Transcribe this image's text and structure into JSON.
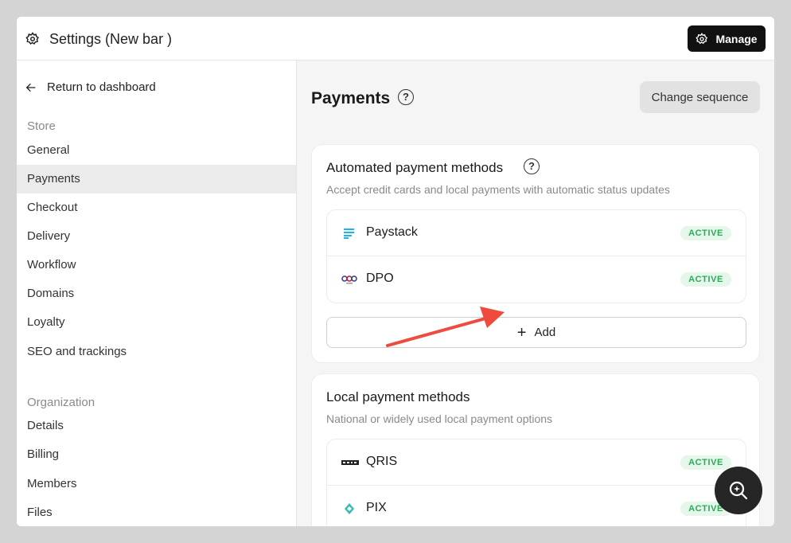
{
  "header": {
    "title": "Settings (New bar )",
    "manage_label": "Manage"
  },
  "sidebar": {
    "back_label": "Return to dashboard",
    "store_label": "Store",
    "store_items": [
      "General",
      "Payments",
      "Checkout",
      "Delivery",
      "Workflow",
      "Domains",
      "Loyalty",
      "SEO and trackings"
    ],
    "active_item": "Payments",
    "org_label": "Organization",
    "org_items": [
      "Details",
      "Billing",
      "Members",
      "Files"
    ]
  },
  "main": {
    "title": "Payments",
    "help_glyph": "?",
    "change_sequence_label": "Change sequence",
    "automated": {
      "title": "Automated payment methods",
      "subtitle": "Accept credit cards and local payments with automatic status updates",
      "methods": [
        {
          "name": "Paystack",
          "status": "ACTIVE",
          "icon": "paystack-logo"
        },
        {
          "name": "DPO",
          "status": "ACTIVE",
          "icon": "dpo-logo"
        }
      ],
      "add_label": "Add"
    },
    "local": {
      "title": "Local payment methods",
      "subtitle": "National or widely used local payment options",
      "methods": [
        {
          "name": "QRIS",
          "status": "ACTIVE",
          "icon": "qris-logo"
        },
        {
          "name": "PIX",
          "status": "ACTIVE",
          "icon": "pix-logo"
        }
      ]
    }
  },
  "colors": {
    "accent_dark": "#111111",
    "active_badge_bg": "#e5f6ea",
    "active_badge_text": "#2fa85a",
    "arrow": "#f04a3e"
  }
}
